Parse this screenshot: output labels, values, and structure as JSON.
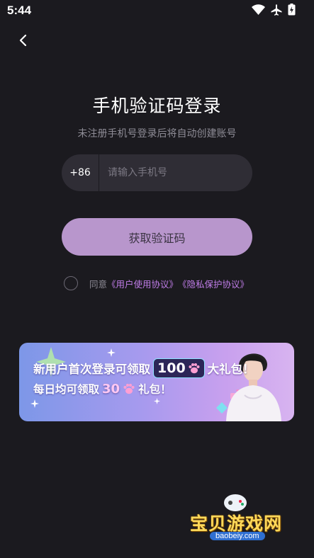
{
  "status_bar": {
    "time": "5:44"
  },
  "login": {
    "title": "手机验证码登录",
    "subtitle": "未注册手机号登录后将自动创建账号",
    "country_code": "+86",
    "phone_placeholder": "请输入手机号",
    "phone_value": "",
    "get_code_label": "获取验证码",
    "agree_prefix": "同意",
    "user_agreement": "《用户使用协议》",
    "privacy_agreement": "《隐私保护协议》"
  },
  "banner": {
    "line1_prefix": "新用户首次登录可领取",
    "line1_amount": "100",
    "line1_suffix": "大礼包！",
    "line2_prefix": "每日均可领取",
    "line2_amount": "30",
    "line2_suffix": "礼包！"
  },
  "watermark": {
    "name": "宝贝游戏网",
    "url": "baobeiy.com"
  },
  "colors": {
    "background": "#1b1a1f",
    "input_bg": "#2f2d35",
    "button_bg": "#b896cc",
    "link": "#c07de8"
  }
}
